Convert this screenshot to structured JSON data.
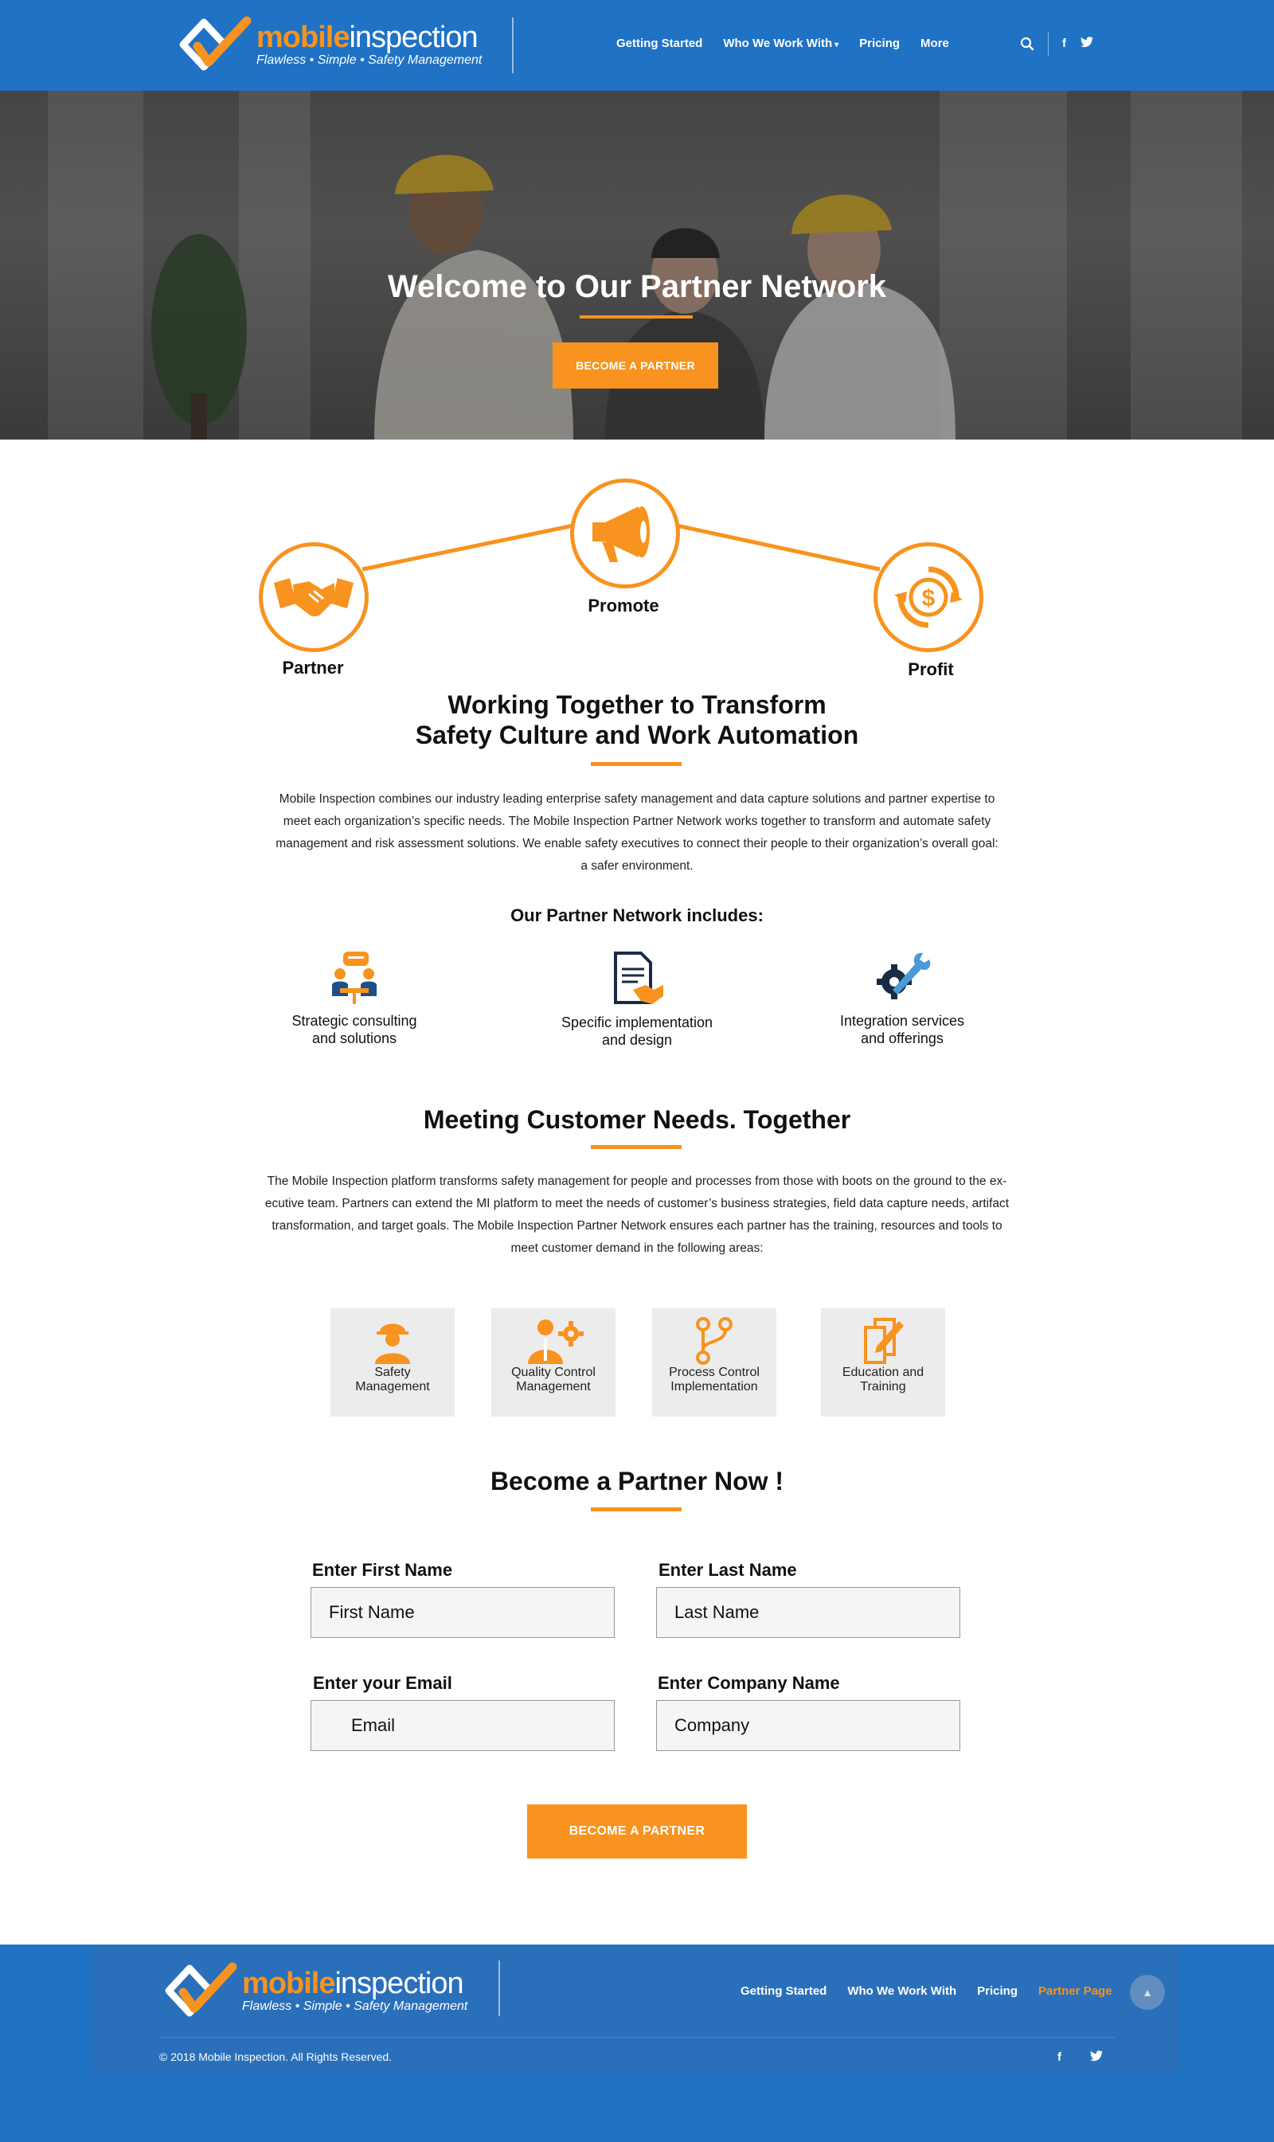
{
  "header": {
    "logo": {
      "word1": "mobile",
      "word2": "inspection",
      "tagline": "Flawless • Simple • Safety Management"
    },
    "nav": [
      "Getting Started",
      "Who We Work With",
      "Pricing",
      "More"
    ],
    "icons": [
      "search-icon",
      "facebook-icon",
      "twitter-icon"
    ],
    "social": {
      "facebook": "f",
      "twitter": "t"
    }
  },
  "hero": {
    "title": "Welcome to Our Partner Network",
    "button": "BECOME A PARTNER"
  },
  "triad": {
    "partner": "Partner",
    "promote": "Promote",
    "profit": "Profit"
  },
  "working": {
    "title_line1": "Working Together to Transform",
    "title_line2": "Safety Culture and Work Automation",
    "para_lines": [
      "Mobile Inspection combines our industry leading enterprise safety management and data capture solutions and partner expertise to",
      "meet each organization’s specific needs. The Mobile Inspection Partner Network works together to transform and automate safety",
      "management and risk assessment solutions. We enable safety executives to connect their people to their organization’s overall goal:",
      "a safer environment."
    ]
  },
  "includes": {
    "title": "Our Partner Network includes:",
    "items": [
      {
        "line1": "Strategic consulting",
        "line2": "and solutions"
      },
      {
        "line1": "Specific implementation",
        "line2": "and design"
      },
      {
        "line1": "Integration services",
        "line2": "and offerings"
      }
    ]
  },
  "meeting": {
    "title": "Meeting Customer Needs. Together",
    "para_lines": [
      "The Mobile Inspection platform transforms safety management for people and processes from those with boots on the ground to the ex-",
      "ecutive team. Partners can extend the MI platform to meet the needs of customer’s business strategies, field data capture needs, artifact",
      "transformation, and target goals. The Mobile Inspection Partner Network ensures each partner has the training, resources and tools to",
      "meet customer demand in the following areas:"
    ],
    "cards": [
      {
        "line1": "Safety",
        "line2": "Management"
      },
      {
        "line1": "Quality Control",
        "line2": "Management"
      },
      {
        "line1": "Process Control",
        "line2": "Implementation"
      },
      {
        "line1": "Education and",
        "line2": "Training"
      }
    ]
  },
  "form": {
    "title": "Become a Partner Now !",
    "first_label": "Enter First Name",
    "first_placeholder": "First Name",
    "last_label": "Enter Last Name",
    "last_placeholder": "Last Name",
    "email_label": "Enter your Email",
    "email_placeholder": "Email",
    "company_label": "Enter Company Name",
    "company_placeholder": "Company",
    "submit": "BECOME A PARTNER"
  },
  "footer": {
    "nav": [
      "Getting Started",
      "Who We Work With",
      "Pricing",
      "Partner Page"
    ],
    "copyright": "© 2018 Mobile Inspection. All Rights Reserved."
  },
  "colors": {
    "brand_blue": "#1f72c4",
    "accent_orange": "#f7931e"
  }
}
